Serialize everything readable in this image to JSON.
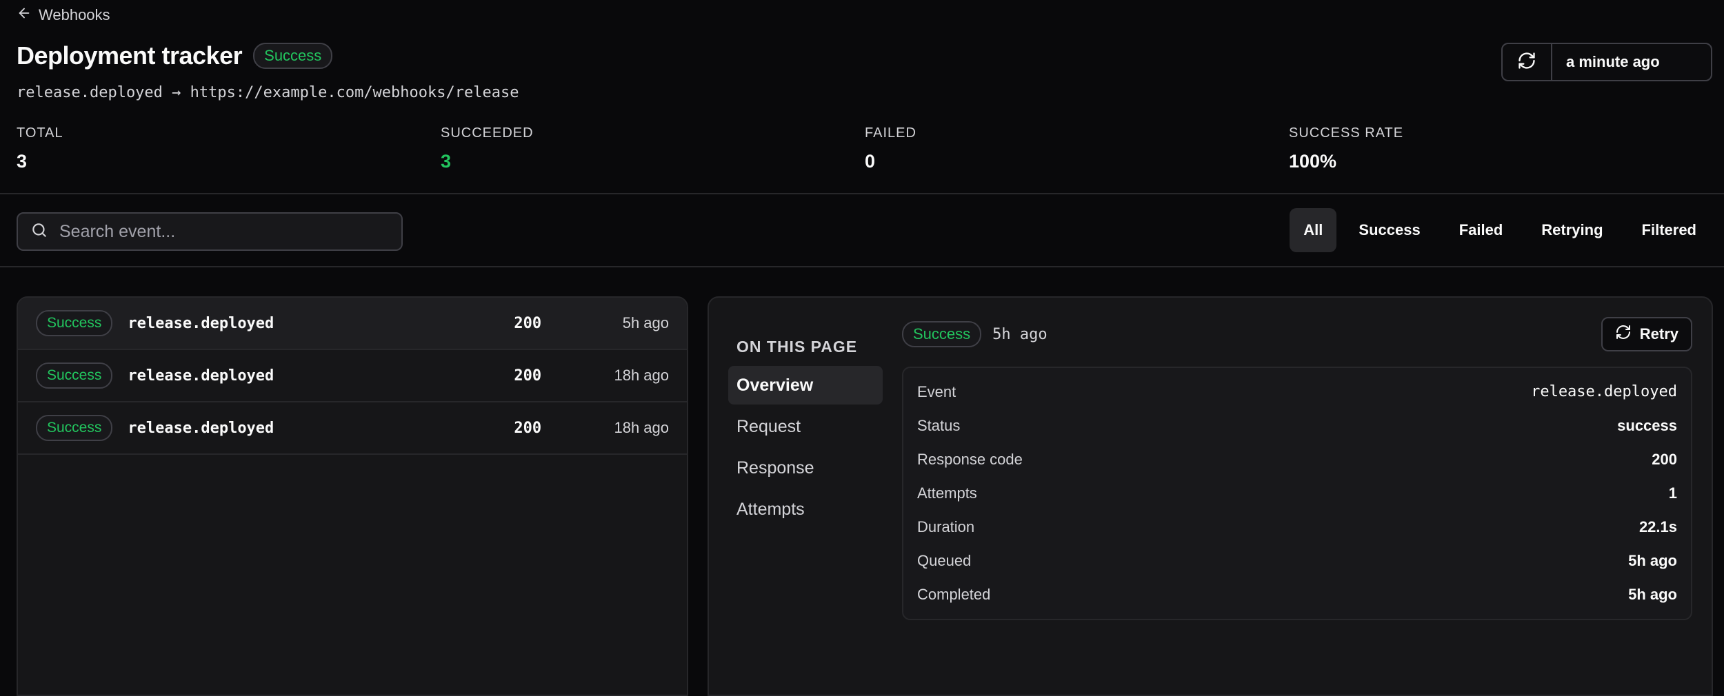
{
  "header": {
    "back_label": "Webhooks",
    "title": "Deployment tracker",
    "status_badge": "Success",
    "subtitle": "release.deployed → https://example.com/webhooks/release",
    "refreshed": "a minute ago"
  },
  "stats": [
    {
      "label": "TOTAL",
      "value": "3"
    },
    {
      "label": "SUCCEEDED",
      "value": "3"
    },
    {
      "label": "FAILED",
      "value": "0"
    },
    {
      "label": "SUCCESS RATE",
      "value": "100%"
    }
  ],
  "search": {
    "placeholder": "Search event...",
    "value": ""
  },
  "filters": [
    "All",
    "Success",
    "Failed",
    "Retrying",
    "Filtered"
  ],
  "events": [
    {
      "status": "Success",
      "event": "release.deployed",
      "code": "200",
      "time": "5h ago"
    },
    {
      "status": "Success",
      "event": "release.deployed",
      "code": "200",
      "time": "18h ago"
    },
    {
      "status": "Success",
      "event": "release.deployed",
      "code": "200",
      "time": "18h ago"
    }
  ],
  "detail": {
    "toc_heading": "ON THIS PAGE",
    "toc": [
      "Overview",
      "Request",
      "Response",
      "Attempts"
    ],
    "status_badge": "Success",
    "time": "5h  ago",
    "retry_label": "Retry",
    "fields": [
      {
        "key": "Event",
        "value": "release.deployed"
      },
      {
        "key": "Status",
        "value": "success"
      },
      {
        "key": "Response code",
        "value": "200"
      },
      {
        "key": "Attempts",
        "value": "1"
      },
      {
        "key": "Duration",
        "value": "22.1s"
      },
      {
        "key": "Queued",
        "value": "5h ago"
      },
      {
        "key": "Completed",
        "value": "5h ago"
      }
    ]
  },
  "colors": {
    "background": "#09090b",
    "panel": "#161618",
    "success": "#22c55e",
    "border": "#27272a"
  },
  "icons": [
    "arrow-left-icon",
    "refresh-icon",
    "search-icon"
  ]
}
